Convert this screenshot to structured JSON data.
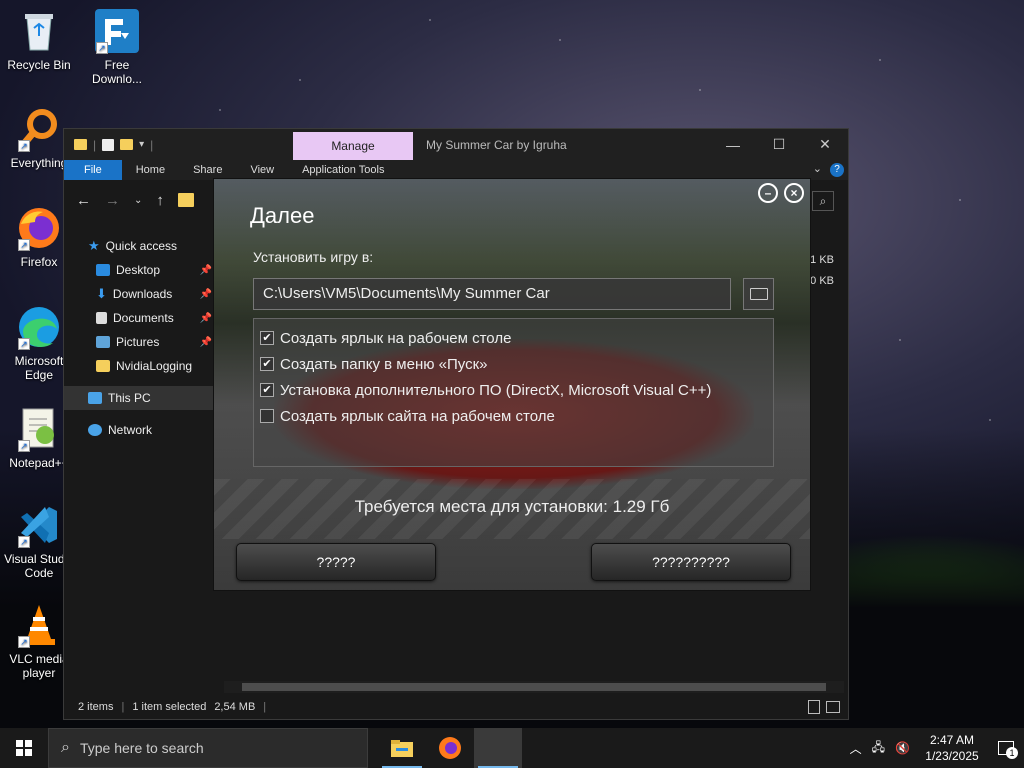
{
  "desktop": {
    "icons": [
      {
        "label": "Recycle Bin"
      },
      {
        "label": "Free Downlo..."
      },
      {
        "label": "Everything"
      },
      {
        "label": "Firefox"
      },
      {
        "label": "Microsoft Edge"
      },
      {
        "label": "Notepad++"
      },
      {
        "label": "Visual Studio Code"
      },
      {
        "label": "VLC media player"
      }
    ]
  },
  "explorer": {
    "title": "My Summer Car by Igruha",
    "manage_tab": "Manage",
    "ribbon_tabs": [
      "File",
      "Home",
      "Share",
      "View",
      "Application Tools"
    ],
    "sidebar": [
      {
        "label": "Quick access"
      },
      {
        "label": "Desktop"
      },
      {
        "label": "Downloads"
      },
      {
        "label": "Documents"
      },
      {
        "label": "Pictures"
      },
      {
        "label": "NvidiaLogging"
      },
      {
        "label": "This PC"
      },
      {
        "label": "Network"
      }
    ],
    "file_sizes": [
      "1 KB",
      "0 KB"
    ],
    "status": {
      "items": "2 items",
      "selected": "1 item selected",
      "size": "2,54 MB"
    }
  },
  "installer": {
    "title": "Далее",
    "install_label": "Установить игру в:",
    "path": "C:\\Users\\VM5\\Documents\\My Summer Car",
    "options": [
      {
        "label": "Создать ярлык на рабочем столе",
        "checked": true
      },
      {
        "label": "Создать папку в меню «Пуск»",
        "checked": true
      },
      {
        "label": "Установка дополнительного ПО (DirectX, Microsoft Visual C++)",
        "checked": true
      },
      {
        "label": "Создать ярлык сайта на рабочем столе",
        "checked": false
      }
    ],
    "space_required": "Требуется места для установки: 1.29 Гб",
    "back_button": "?????",
    "next_button": "??????????"
  },
  "taskbar": {
    "search_placeholder": "Type here to search",
    "time": "2:47 AM",
    "date": "1/23/2025",
    "notification_count": "1"
  }
}
